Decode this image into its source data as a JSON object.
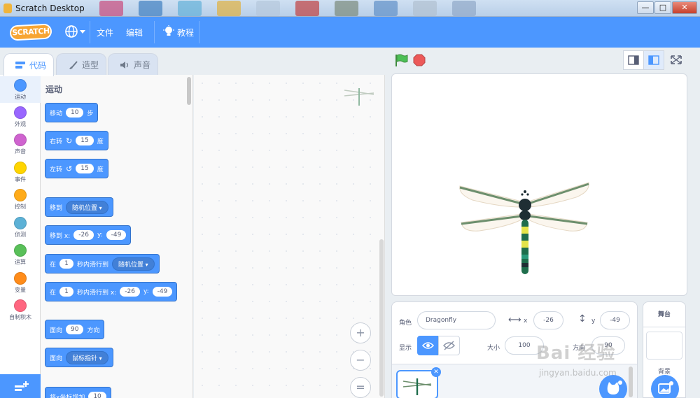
{
  "window": {
    "title": "Scratch Desktop",
    "minimize": "—",
    "maximize": "□",
    "close": "✕"
  },
  "menubar": {
    "logo": "SCRATCH",
    "file": "文件",
    "edit": "编辑",
    "tutorials": "教程"
  },
  "tabs": [
    {
      "label": "代码"
    },
    {
      "label": "造型"
    },
    {
      "label": "声音"
    }
  ],
  "categories": [
    {
      "label": "运动",
      "color": "#4c97ff"
    },
    {
      "label": "外观",
      "color": "#9966ff"
    },
    {
      "label": "声音",
      "color": "#cf63cf"
    },
    {
      "label": "事件",
      "color": "#ffd500"
    },
    {
      "label": "控制",
      "color": "#ffab19"
    },
    {
      "label": "侦测",
      "color": "#5cb1d6"
    },
    {
      "label": "运算",
      "color": "#59c059"
    },
    {
      "label": "变量",
      "color": "#ff8c1a"
    },
    {
      "label": "自制积木",
      "color": "#ff6680"
    }
  ],
  "palette": {
    "section_title": "运动",
    "blocks": {
      "move": {
        "a": "移动",
        "v": "10",
        "b": "步"
      },
      "turn_right": {
        "a": "右转",
        "v": "15",
        "b": "度"
      },
      "turn_left": {
        "a": "左转",
        "v": "15",
        "b": "度"
      },
      "goto": {
        "a": "移到",
        "dd": "随机位置"
      },
      "goto_xy": {
        "a": "移到 x:",
        "x": "-26",
        "b": "y:",
        "y": "-49"
      },
      "glide": {
        "a": "在",
        "v": "1",
        "b": "秒内滑行到",
        "dd": "随机位置"
      },
      "glide_xy": {
        "a": "在",
        "v": "1",
        "b": "秒内滑行到 x:",
        "x": "-26",
        "c": "y:",
        "y": "-49"
      },
      "point_dir": {
        "a": "面向",
        "v": "90",
        "b": "方向"
      },
      "point_towards": {
        "a": "面向",
        "dd": "鼠标指针"
      },
      "change_x": {
        "a": "将x坐标增加",
        "v": "10"
      }
    }
  },
  "zoom": {
    "in": "+",
    "out": "−",
    "reset": "="
  },
  "sprite_info": {
    "sprite_label": "角色",
    "sprite_name": "Dragonfly",
    "x_label": "x",
    "x_value": "-26",
    "y_label": "y",
    "y_value": "-49",
    "show_label": "显示",
    "size_label": "大小",
    "size_value": "100",
    "direction_label": "方向",
    "direction_value": "90"
  },
  "stage_selector": {
    "title": "舞台",
    "backdrops_label": "背景"
  },
  "watermark": {
    "text": "Bai 经验",
    "url": "jingyan.baidu.com"
  }
}
